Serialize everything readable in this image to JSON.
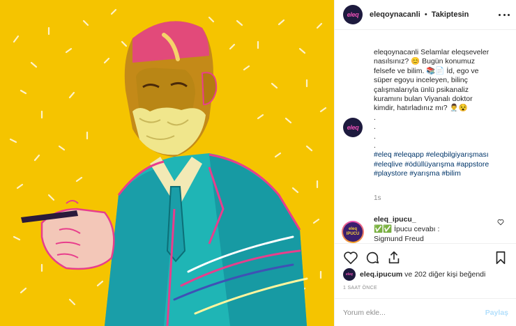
{
  "header": {
    "avatar_text": "eleq",
    "username": "eleqoynacanli",
    "separator": "•",
    "follow_status": "Takiptesin"
  },
  "caption": {
    "username": "eleqoynacanli",
    "lines": [
      "Selamlar eleqseveler",
      "nasılsınız? 😊 Bugün konumuz",
      "felsefe ve bilim. 📚📄 İd, ego ve",
      "süper egoyu inceleyen, bilinç",
      "çalışmalarıyla ünlü psikanaliz",
      "kuramını bulan Viyanalı doktor",
      "kimdir, hatırladınız mı? 👨‍⚕️😵"
    ],
    "dots": [
      ".",
      ".",
      ".",
      "."
    ],
    "hashtag_lines": [
      "#eleq #eleqapp #eleqbilgiyarışması",
      "#eleqlive #ödüllüyarışma #appstore",
      "#playstore #yarışma #bilim"
    ],
    "time": "1s"
  },
  "comment2": {
    "avatar_top": "eleq",
    "avatar_bottom": "IPUCU",
    "username": "eleq_ipucu_",
    "line1": " ✅✅ İpucu cevabı :",
    "line2": "Sigmund Freud"
  },
  "likes": {
    "avatar_text": "eleq",
    "user": "eleq.ipucum",
    "rest": " ve 202 diğer kişi beğendi"
  },
  "timestamp": "1 SAAT ÖNCE",
  "comment_box": {
    "placeholder": "Yorum ekle...",
    "post_label": "Paylaş"
  },
  "icons": [
    "heart-icon",
    "comment-icon",
    "share-icon",
    "bookmark-icon",
    "more-icon",
    "small-heart-icon"
  ],
  "colors": {
    "background_yellow": "#f5c400",
    "magenta": "#e83e8c",
    "teal": "#1fb5b5",
    "hashtag": "#003569",
    "post_button": "#b2dffc"
  }
}
